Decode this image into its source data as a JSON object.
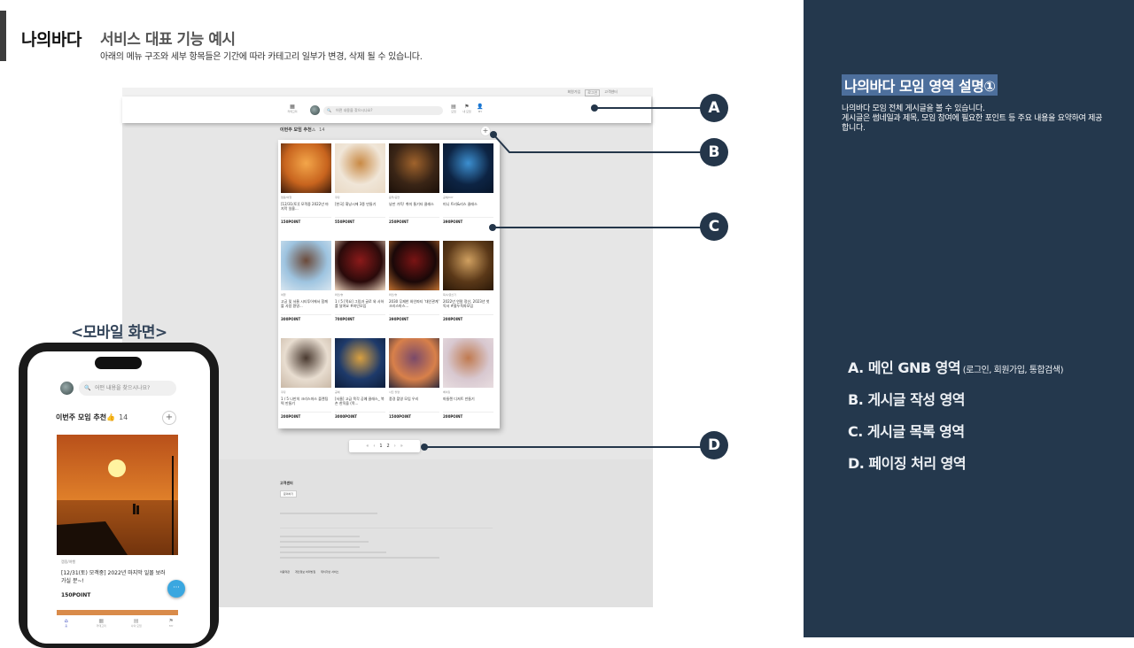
{
  "header": {
    "brand": "나의바다",
    "title": "서비스 대표 기능 예시",
    "description": "아래의 메뉴 구조와 세부 항목들은 기간에 따라 카테고리 일부가 변경, 삭제 될 수 있습니다."
  },
  "desktop": {
    "top_links": [
      "회원가입",
      "로그인",
      "고객센터"
    ],
    "gnb": {
      "search_placeholder": "어떤 내용을 찾으시나요?",
      "icons": [
        {
          "icon": "grid-icon",
          "label": "카테고리"
        },
        {
          "icon": "board-icon",
          "label": "모임"
        },
        {
          "icon": "flag-icon",
          "label": "내 모임"
        },
        {
          "icon": "user-icon",
          "label": "MY"
        }
      ]
    },
    "section_title": "이번주 모임 추천",
    "section_count": "14",
    "cards": [
      {
        "cat": "캠핑/여행",
        "title": "[12/31(토)] 모객중 2022년 마지막 일몰...",
        "point": "150POINT",
        "color": "sunset"
      },
      {
        "cat": "쿠킹",
        "title": "[한국] 휘낭시에 3종 만들기",
        "point": "550POINT",
        "color": "bread"
      },
      {
        "cat": "음악/공연",
        "title": "낭만 가득! 취미 통기타 클래스",
        "point": "250POINT",
        "color": "guitar"
      },
      {
        "cat": "공예/DIY",
        "title": "미니 트리&리스 클래스",
        "point": "390POINT",
        "color": "tree"
      },
      {
        "cat": "여행",
        "title": "고궁 및 서울 시티투어에서 함께 볼 사람 환영...",
        "point": "300POINT",
        "color": "palace"
      },
      {
        "cat": "와인/술",
        "title": "1 / 5 [목요] 그림과 글로 와 사하를 달여요 #와인모임",
        "point": "700POINT",
        "color": "wine1"
      },
      {
        "cat": "와인/술",
        "title": "2030 무제한 와인파티 '대인관계' 크리스마스...",
        "point": "390POINT",
        "color": "wine2"
      },
      {
        "cat": "독서/글쓰기",
        "title": "2022년 연말 정산, 2023년 첫 독서 #몰두독파모임",
        "point": "200POINT",
        "color": "books"
      },
      {
        "cat": "쿠킹",
        "title": "1 / 5 나만의 크리스마스 플랜팅 떡 만들기",
        "point": "200POINT",
        "color": "cakes"
      },
      {
        "cat": "공예",
        "title": "[서울] 고급 목각 공예 클래스_ 북촌 한옥을 (목...",
        "point": "3000POINT",
        "color": "house"
      },
      {
        "cat": "사진 촬영",
        "title": "풍경 촬영 모임 우리",
        "point": "1500POINT",
        "color": "dusk"
      },
      {
        "cat": "베이킹",
        "title": "마들렌 디저트 만들기",
        "point": "200POINT",
        "color": "cookies"
      }
    ],
    "paging": [
      "«",
      "‹",
      "1",
      "2",
      "›",
      "»"
    ],
    "footer": {
      "title": "고객센터",
      "button": "문의하기",
      "links": [
        "이용약관",
        "개인정보 처리방침",
        "위치기반 서비스"
      ]
    }
  },
  "callouts": [
    "A",
    "B",
    "C",
    "D"
  ],
  "mobile": {
    "label": "<모바일 화면>",
    "search_placeholder": "어떤 내용을 찾으시나요?",
    "section_title": "이번주 모임 추천",
    "section_count": "14",
    "card": {
      "category": "캠핑/여행",
      "title": "[12/31(토) 모객중] 2022년 마지막 일몰 보러가실 분~!",
      "point": "150POINT"
    },
    "chat_label": "···",
    "nav": [
      {
        "icon": "home-icon",
        "label": "홈"
      },
      {
        "icon": "grid-icon",
        "label": "카테고리"
      },
      {
        "icon": "board-icon",
        "label": "나의 모임"
      },
      {
        "icon": "flag-icon",
        "label": "MY"
      }
    ]
  },
  "panel": {
    "title": "나의바다 모임 영역 설명①",
    "description": [
      "나의바다 모임 전체 게시글을 볼 수 있습니다.",
      "게시글은 썸네일과 제목, 모임 참여에 필요한 포인트 등 주요 내용을 요약하여 제공합니다."
    ],
    "items": [
      {
        "main": "A. 메인 GNB 영역",
        "sub": " (로그인, 회원가입, 통합검색)"
      },
      {
        "main": "B. 게시글 작성 영역",
        "sub": ""
      },
      {
        "main": "C. 게시글 목록 영역",
        "sub": ""
      },
      {
        "main": "D. 페이징 처리 영역",
        "sub": ""
      }
    ]
  },
  "colors": {
    "navy": "#24384d",
    "accent": "#4d6f9c"
  }
}
